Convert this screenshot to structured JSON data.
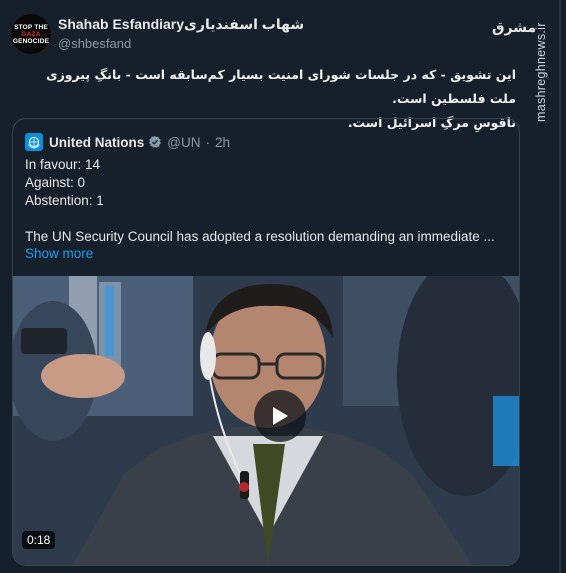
{
  "tweet": {
    "avatar_lines": [
      "STOP THE",
      "GAZA",
      "GENOCIDE"
    ],
    "display_name": "Shahab Esfandiaryشهاب اسفندیاری",
    "handle": "@shbesfand",
    "text_line1": "این تشویق - که در جلسات شورای امنیت بسیار کم‌سابقه است - بانگِ پیروزی ملت فلسطین است.",
    "text_line2": "ناقوسِ مرگِ اسرائیل است."
  },
  "quote": {
    "name": "United Nations",
    "handle": "@UN",
    "separator": "·",
    "time": "2h",
    "lines": [
      "In favour: 14",
      "Against: 0",
      "Abstention: 1"
    ],
    "text": "The UN Security Council has adopted a resolution demanding an immediate ...",
    "show_more": "Show more",
    "video_duration": "0:18"
  },
  "watermark": {
    "logo": "مشرق",
    "site": "mashreghnews.ir"
  },
  "colors": {
    "background": "#15202b",
    "link": "#1d9bf0",
    "border": "#38444d",
    "verified_badge": "#829aab",
    "un_blue": "#0a8fdc"
  },
  "icons": [
    "avatar-image",
    "un-logo-icon",
    "verified-badge-icon",
    "play-icon"
  ]
}
